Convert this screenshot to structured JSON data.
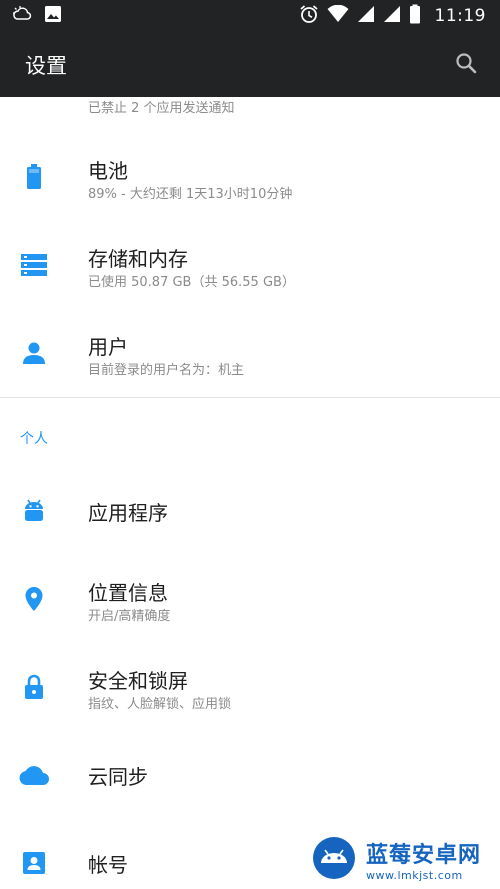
{
  "status_bar": {
    "time": "11:19",
    "icons": [
      "weather-icon",
      "image-icon",
      "alarm-icon",
      "wifi-icon",
      "signal-icon",
      "signal-icon-2",
      "battery-icon"
    ]
  },
  "app_bar": {
    "title": "设置",
    "search_icon": "search-icon"
  },
  "settings": {
    "partial_summary": "已禁止 2 个应用发送通知",
    "items": [
      {
        "title": "电池",
        "summary": "89% - 大约还剩 1天13小时10分钟",
        "icon": "battery-icon"
      },
      {
        "title": "存储和内存",
        "summary": "已使用 50.87 GB（共 56.55 GB）",
        "icon": "storage-icon"
      },
      {
        "title": "用户",
        "summary": "目前登录的用户名为：机主",
        "icon": "user-icon"
      }
    ],
    "personal_header": "个人",
    "personal_items": [
      {
        "title": "应用程序",
        "summary": "",
        "icon": "android-icon"
      },
      {
        "title": "位置信息",
        "summary": "开启/高精确度",
        "icon": "location-icon"
      },
      {
        "title": "安全和锁屏",
        "summary": "指纹、人脸解锁、应用锁",
        "icon": "lock-icon"
      },
      {
        "title": "云同步",
        "summary": "",
        "icon": "cloud-icon"
      },
      {
        "title": "帐号",
        "summary": "",
        "icon": "account-icon"
      }
    ]
  },
  "watermark": {
    "name": "蓝莓安卓网",
    "url": "www.lmkjst.com"
  },
  "colors": {
    "bar_background": "#222324",
    "accent": "#2196f3",
    "title_text": "#1f1f1f",
    "summary_text": "#8b8b8b"
  }
}
